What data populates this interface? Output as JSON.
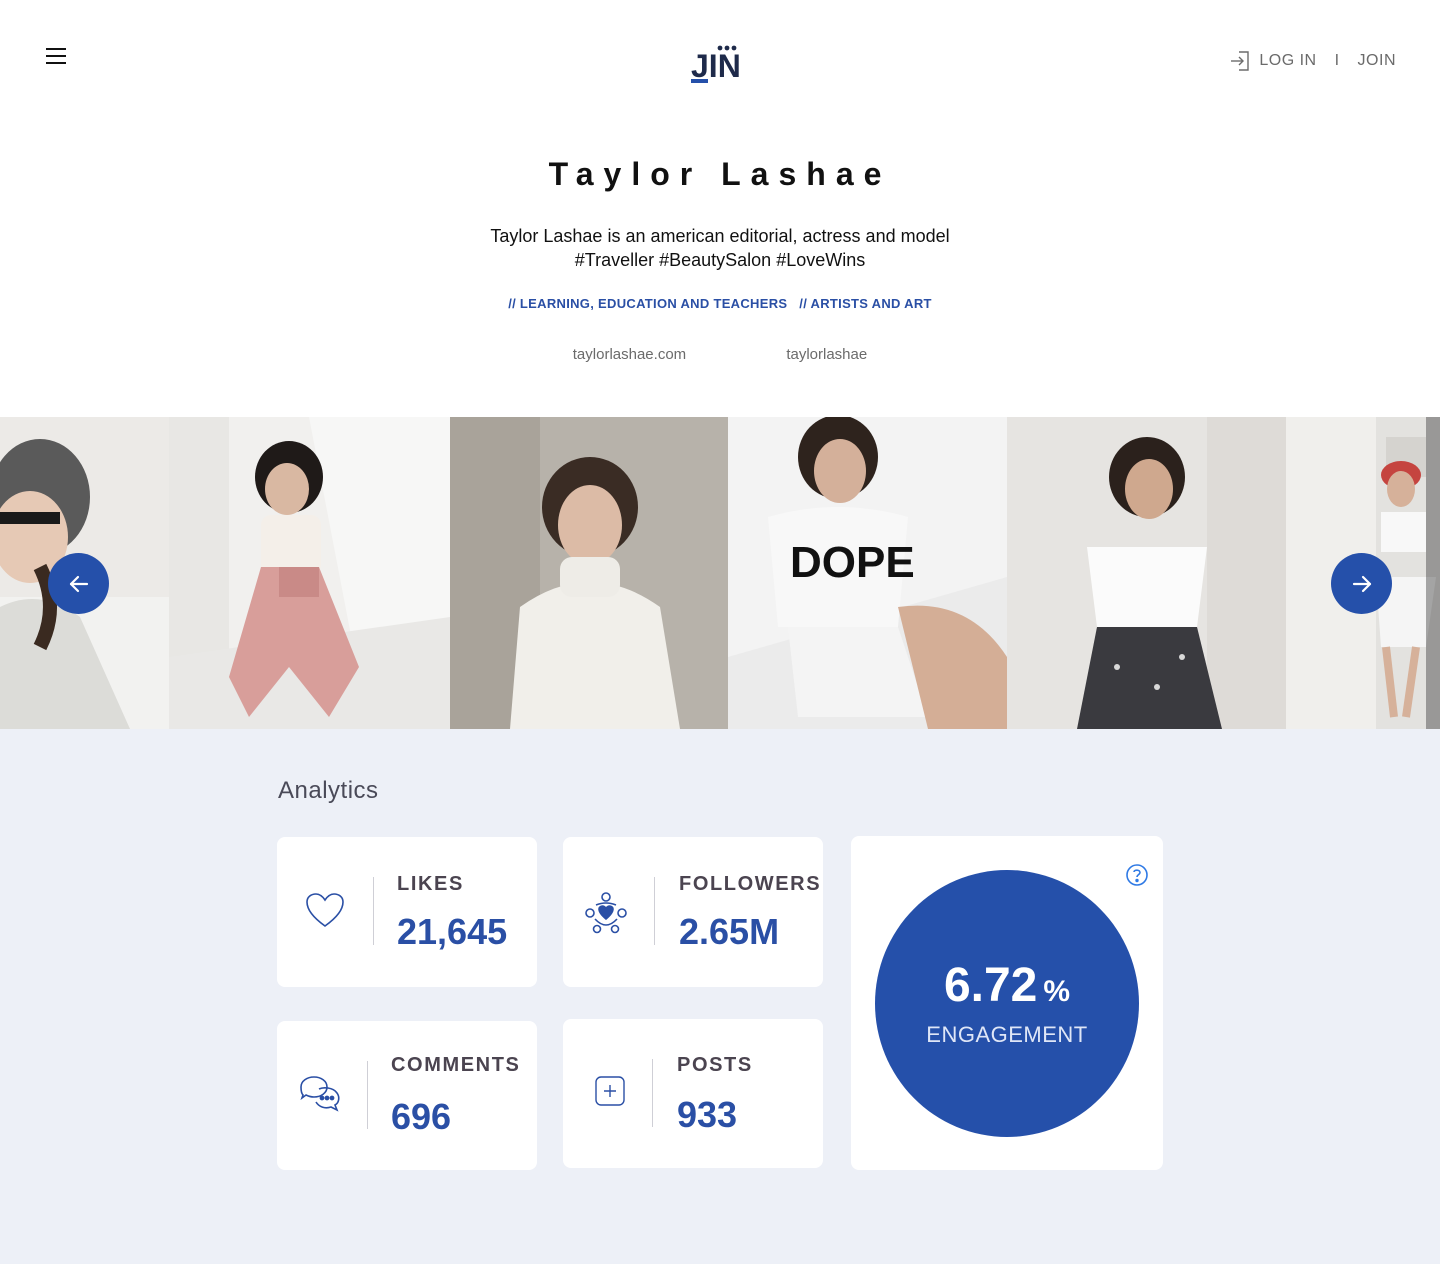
{
  "header": {
    "logo_text": "JIN",
    "login_label": "LOG IN",
    "separator": "I",
    "join_label": "JOIN"
  },
  "profile": {
    "name": "Taylor Lashae",
    "bio_line1": "Taylor Lashae is an american editorial, actress and model",
    "bio_line2": "#Traveller #BeautySalon #LoveWins",
    "categories": [
      "// LEARNING, EDUCATION AND TEACHERS",
      "// ARTISTS AND ART"
    ],
    "website": "taylorlashae.com",
    "handle": "taylorlashae"
  },
  "gallery": {
    "photos": [
      {
        "alt": "photo-beret-sunglasses"
      },
      {
        "alt": "photo-pink-overalls"
      },
      {
        "alt": "photo-white-turtleneck"
      },
      {
        "alt": "photo-dope-tshirt"
      },
      {
        "alt": "photo-off-shoulder-top"
      },
      {
        "alt": "photo-red-beret"
      }
    ]
  },
  "analytics": {
    "title": "Analytics",
    "likes": {
      "label": "LIKES",
      "value": "21,645"
    },
    "followers": {
      "label": "FOLLOWERS",
      "value": "2.65M"
    },
    "comments": {
      "label": "COMMENTS",
      "value": "696"
    },
    "posts": {
      "label": "POSTS",
      "value": "933"
    },
    "engagement": {
      "value": "6.72",
      "unit": "%",
      "label": "ENGAGEMENT"
    }
  },
  "colors": {
    "accent": "#2550aa",
    "background": "#edf0f7"
  },
  "icons": {
    "menu": "hamburger-icon",
    "login": "login-arrow-icon",
    "prev": "arrow-left-icon",
    "next": "arrow-right-icon",
    "likes": "heart-icon",
    "followers": "community-icon",
    "comments": "chat-bubbles-icon",
    "posts": "plus-square-icon",
    "help": "question-icon"
  }
}
